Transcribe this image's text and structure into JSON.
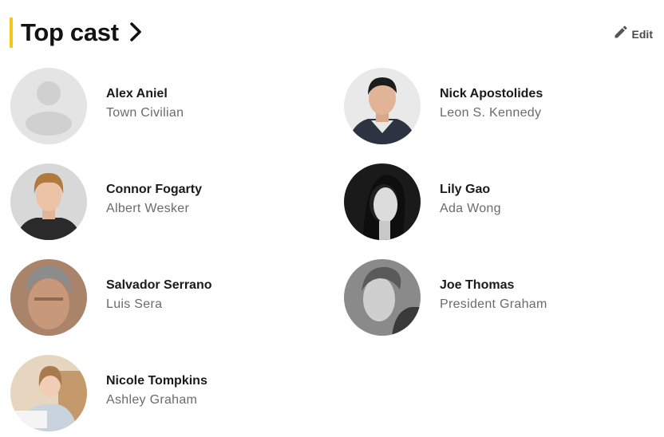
{
  "section": {
    "title": "Top cast",
    "edit_label": "Edit",
    "accent_color": "#f5c518",
    "title_icon": "chevron-right-icon",
    "edit_icon": "pencil-icon"
  },
  "cast": [
    {
      "name": "Alex Aniel",
      "character": "Town Civilian",
      "photo": "placeholder-avatar-icon"
    },
    {
      "name": "Nick Apostolides",
      "character": "Leon S. Kennedy",
      "photo": "headshot"
    },
    {
      "name": "Connor Fogarty",
      "character": "Albert Wesker",
      "photo": "headshot"
    },
    {
      "name": "Lily Gao",
      "character": "Ada Wong",
      "photo": "headshot"
    },
    {
      "name": "Salvador Serrano",
      "character": "Luis Sera",
      "photo": "headshot"
    },
    {
      "name": "Joe Thomas",
      "character": "President Graham",
      "photo": "headshot"
    },
    {
      "name": "Nicole Tompkins",
      "character": "Ashley Graham",
      "photo": "headshot"
    }
  ]
}
